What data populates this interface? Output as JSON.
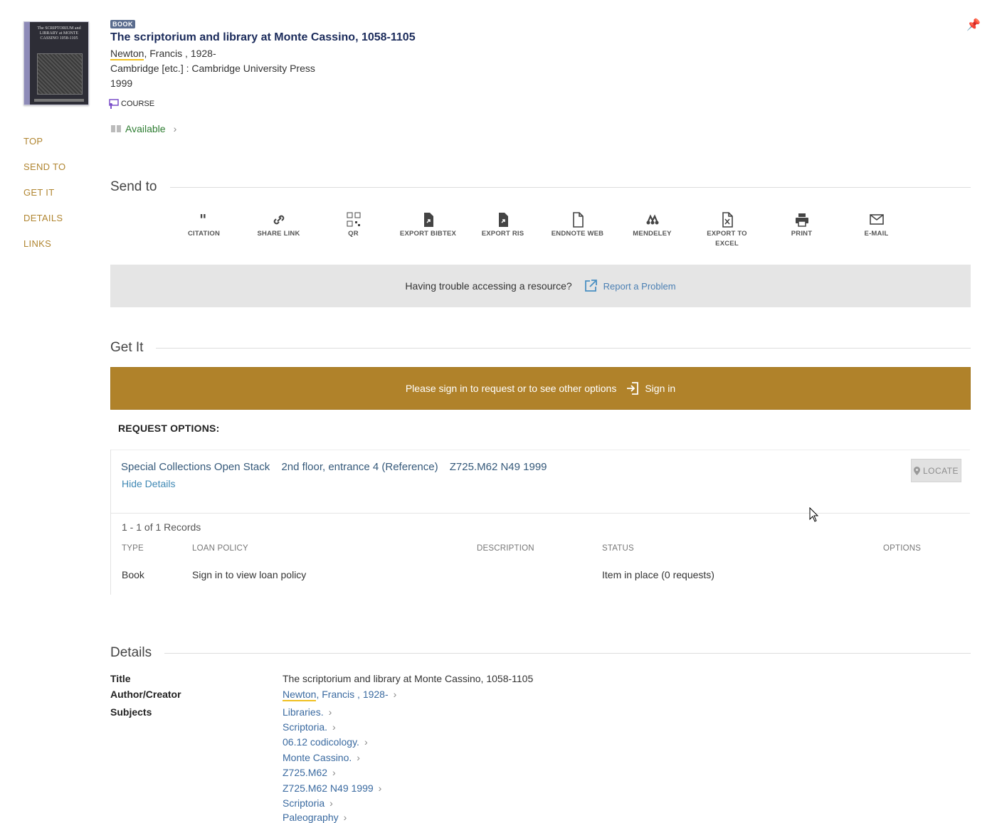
{
  "record": {
    "type_badge": "BOOK",
    "title": "The scriptorium and library at Monte Cassino, 1058-1105",
    "author_highlight": "Newton",
    "author_rest": ", Francis , 1928-",
    "publisher": "Cambridge [etc.] : Cambridge University Press",
    "year": "1999",
    "course_label": "COURSE",
    "availability": "Available",
    "cover_text": "The SCRIPTORIUM and LIBRARY at MONTE CASSINO 1058-1105"
  },
  "left_nav": [
    "TOP",
    "SEND TO",
    "GET IT",
    "DETAILS",
    "LINKS"
  ],
  "send_to": {
    "heading": "Send to",
    "actions": [
      {
        "label": "CITATION",
        "icon": "quote-icon"
      },
      {
        "label": "SHARE LINK",
        "icon": "link-icon"
      },
      {
        "label": "QR",
        "icon": "qr-icon"
      },
      {
        "label": "EXPORT BIBTEX",
        "icon": "file-export-icon"
      },
      {
        "label": "EXPORT RIS",
        "icon": "file-export-icon"
      },
      {
        "label": "ENDNOTE WEB",
        "icon": "file-icon"
      },
      {
        "label": "MENDELEY",
        "icon": "mendeley-icon"
      },
      {
        "label": "EXPORT TO EXCEL",
        "icon": "excel-icon"
      },
      {
        "label": "PRINT",
        "icon": "print-icon"
      },
      {
        "label": "E-MAIL",
        "icon": "mail-icon"
      }
    ]
  },
  "trouble": {
    "text": "Having trouble accessing a resource?",
    "link": "Report a Problem"
  },
  "get_it": {
    "heading": "Get It",
    "signin_prompt": "Please sign in to request or to see other options",
    "signin_button": "Sign in",
    "request_options": "REQUEST OPTIONS:",
    "location": "Special Collections Open Stack",
    "sublocation": "2nd floor, entrance 4 (Reference)",
    "call_number": "Z725.M62 N49 1999",
    "hide_details": "Hide Details",
    "locate": "LOCATE",
    "records_count": "1 - 1 of 1 Records",
    "columns": [
      "TYPE",
      "LOAN POLICY",
      "DESCRIPTION",
      "STATUS",
      "OPTIONS"
    ],
    "row": {
      "type": "Book",
      "loan_policy": "Sign in to view loan policy",
      "description": "",
      "status": "Item in place (0 requests)"
    }
  },
  "details": {
    "heading": "Details",
    "title_label": "Title",
    "title_value": "The scriptorium and library at Monte Cassino, 1058-1105",
    "author_label": "Author/Creator",
    "author_highlight": "Newton",
    "author_rest": ", Francis , 1928-",
    "subjects_label": "Subjects",
    "subjects": [
      "Libraries.",
      "Scriptoria.",
      "06.12 codicology.",
      "Monte Cassino.",
      "Z725.M62",
      "Z725.M62 N49 1999",
      "Scriptoria",
      "Paleography"
    ]
  }
}
